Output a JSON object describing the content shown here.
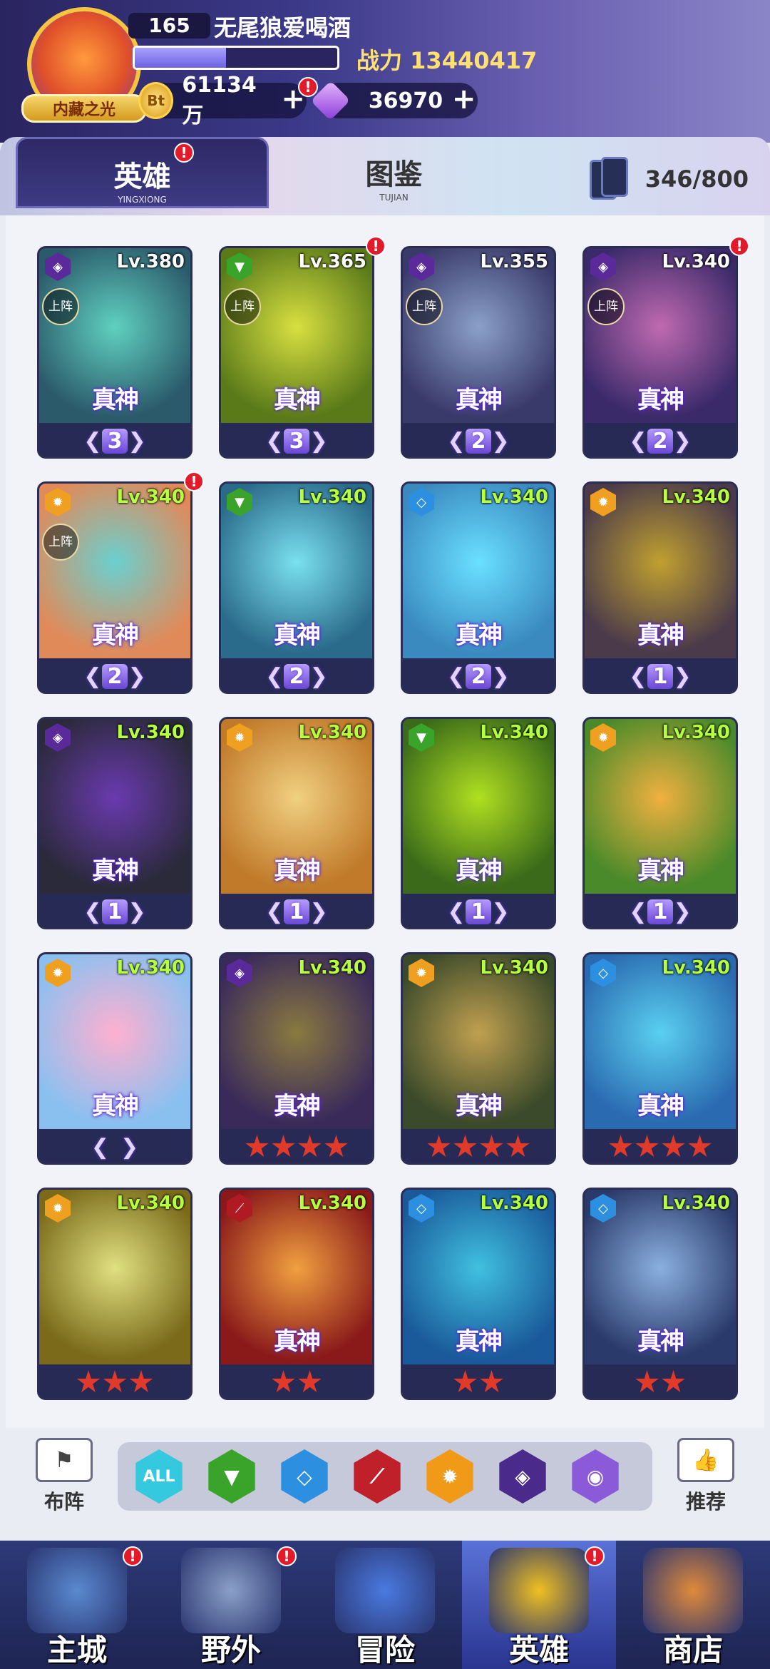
{
  "player": {
    "level": "165",
    "name": "无尾狼爱喝酒",
    "power_label": "战力",
    "power_value": "13440417",
    "avatar_banner": "内藏之光",
    "xp_fraction": 0.45
  },
  "currency": {
    "coin": "61134万",
    "coin_icon": "Bt",
    "gem": "36970",
    "plus": "+"
  },
  "tabs": [
    {
      "label": "英雄",
      "sub": "YINGXIONG"
    },
    {
      "label": "图鉴",
      "sub": "TUJIAN"
    }
  ],
  "card_count": "346/800",
  "rank_label": "真神",
  "onfield_label": "上阵",
  "heroes": [
    {
      "lv": "Lv.380",
      "faction": "dark",
      "onfield": true,
      "rank": true,
      "tier": "wings",
      "tier_val": "3"
    },
    {
      "lv": "Lv.365",
      "faction": "nature",
      "onfield": true,
      "rank": true,
      "tier": "wings",
      "tier_val": "3",
      "alert": true
    },
    {
      "lv": "Lv.355",
      "faction": "dark",
      "onfield": true,
      "rank": true,
      "tier": "wings",
      "tier_val": "2"
    },
    {
      "lv": "Lv.340",
      "faction": "dark",
      "onfield": true,
      "rank": true,
      "tier": "wings",
      "tier_val": "2",
      "alert": true
    },
    {
      "lv": "Lv.340",
      "faction": "light",
      "onfield": true,
      "rank": true,
      "tier": "wings",
      "tier_val": "2",
      "alert": true
    },
    {
      "lv": "Lv.340",
      "faction": "nature",
      "rank": true,
      "tier": "wings",
      "tier_val": "2"
    },
    {
      "lv": "Lv.340",
      "faction": "water",
      "rank": true,
      "tier": "wings",
      "tier_val": "2"
    },
    {
      "lv": "Lv.340",
      "faction": "light",
      "rank": true,
      "tier": "wings",
      "tier_val": "1"
    },
    {
      "lv": "Lv.340",
      "faction": "dark",
      "rank": true,
      "tier": "wings",
      "tier_val": "1"
    },
    {
      "lv": "Lv.340",
      "faction": "light",
      "rank": true,
      "tier": "wings",
      "tier_val": "1"
    },
    {
      "lv": "Lv.340",
      "faction": "nature",
      "rank": true,
      "tier": "wings",
      "tier_val": "1"
    },
    {
      "lv": "Lv.340",
      "faction": "light",
      "rank": true,
      "tier": "wings",
      "tier_val": "1"
    },
    {
      "lv": "Lv.340",
      "faction": "light",
      "rank": true,
      "tier": "wings",
      "tier_val": ""
    },
    {
      "lv": "Lv.340",
      "faction": "dark",
      "rank": true,
      "tier": "stars",
      "tier_val": 4
    },
    {
      "lv": "Lv.340",
      "faction": "light",
      "rank": true,
      "tier": "stars",
      "tier_val": 4
    },
    {
      "lv": "Lv.340",
      "faction": "water",
      "rank": true,
      "tier": "stars",
      "tier_val": 4
    },
    {
      "lv": "Lv.340",
      "faction": "light",
      "rank": false,
      "tier": "stars",
      "tier_val": 3
    },
    {
      "lv": "Lv.340",
      "faction": "fire",
      "rank": true,
      "tier": "stars",
      "tier_val": 2
    },
    {
      "lv": "Lv.340",
      "faction": "water",
      "rank": true,
      "tier": "stars",
      "tier_val": 2
    },
    {
      "lv": "Lv.340",
      "faction": "water",
      "rank": true,
      "tier": "stars",
      "tier_val": 2
    }
  ],
  "filters": [
    {
      "id": "all",
      "label": "ALL",
      "color": "#35c9e0"
    },
    {
      "id": "nature",
      "color": "#3aa32a"
    },
    {
      "id": "water",
      "color": "#2d8fe0"
    },
    {
      "id": "fire",
      "color": "#c0202a"
    },
    {
      "id": "light",
      "color": "#f09a18"
    },
    {
      "id": "dark",
      "color": "#4a2a8a"
    },
    {
      "id": "void",
      "color": "#8a5ad8"
    }
  ],
  "side_buttons": {
    "lineup": "布阵",
    "recommend": "推荐"
  },
  "nav": [
    {
      "label": "主城",
      "alert": true
    },
    {
      "label": "野外",
      "alert": true
    },
    {
      "label": "冒险",
      "alert": false
    },
    {
      "label": "英雄",
      "alert": true,
      "active": true
    },
    {
      "label": "商店",
      "alert": false
    }
  ],
  "colors": {
    "faction": {
      "dark": "#5a2a9a",
      "nature": "#3aa32a",
      "water": "#2d8fe0",
      "light": "#f0a020",
      "fire": "#b01a22"
    }
  }
}
